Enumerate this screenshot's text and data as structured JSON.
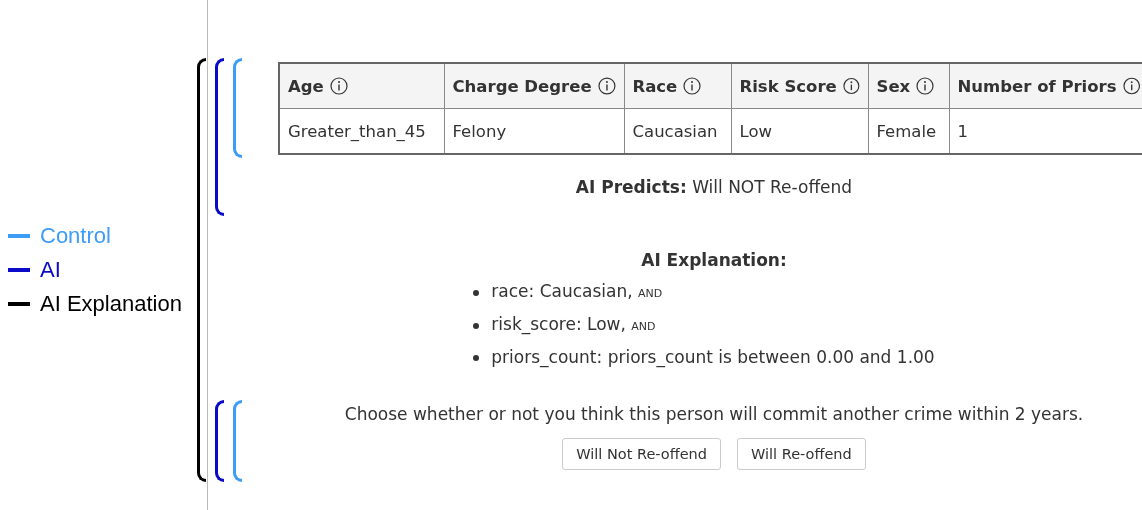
{
  "legend": [
    {
      "label": "Control",
      "color": "#3d9cf5"
    },
    {
      "label": "AI",
      "color": "#0a0ac8"
    },
    {
      "label": "AI Explanation",
      "color": "#000000"
    }
  ],
  "table": {
    "columns": [
      "Age",
      "Charge Degree",
      "Race",
      "Risk Score",
      "Sex",
      "Number of Priors"
    ],
    "rows": [
      [
        "Greater_than_45",
        "Felony",
        "Caucasian",
        "Low",
        "Female",
        "1"
      ]
    ]
  },
  "prediction": "**AI Predicts:** Will NOT Re-offend",
  "explanation": {
    "title": "AI Explanation:",
    "items": [
      {
        "text": "race: Caucasian,",
        "connector": "AND"
      },
      {
        "text": "risk_score: Low,",
        "connector": "AND"
      },
      {
        "text": "priors_count: priors_count is between 0.00 and 1.00"
      }
    ]
  },
  "question": "Choose whether or not you think this person will commit another crime within 2 years.",
  "buttons": [
    "Will Not Re-offend",
    "Will Re-offend"
  ]
}
